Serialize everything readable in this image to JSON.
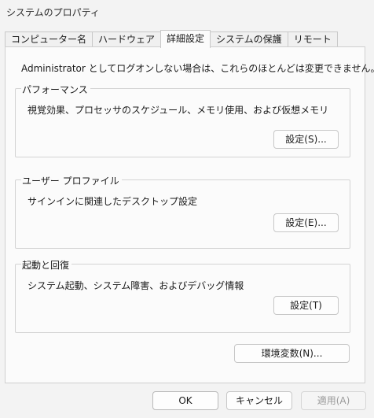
{
  "window": {
    "title": "システムのプロパティ"
  },
  "tabs": [
    {
      "label": "コンピューター名",
      "active": false
    },
    {
      "label": "ハードウェア",
      "active": false
    },
    {
      "label": "詳細設定",
      "active": true
    },
    {
      "label": "システムの保護",
      "active": false
    },
    {
      "label": "リモート",
      "active": false
    }
  ],
  "advanced": {
    "admin_note": "Administrator としてログオンしない場合は、これらのほとんどは変更できません。",
    "performance": {
      "label": "パフォーマンス",
      "description": "視覚効果、プロセッサのスケジュール、メモリ使用、および仮想メモリ",
      "button": "設定(S)..."
    },
    "user_profile": {
      "label": "ユーザー プロファイル",
      "description": "サインインに関連したデスクトップ設定",
      "button": "設定(E)..."
    },
    "startup_recovery": {
      "label": "起動と回復",
      "description": "システム起動、システム障害、およびデバッグ情報",
      "button": "設定(T)"
    },
    "env_button": "環境変数(N)..."
  },
  "footer": {
    "ok": "OK",
    "cancel": "キャンセル",
    "apply": "適用(A)"
  }
}
